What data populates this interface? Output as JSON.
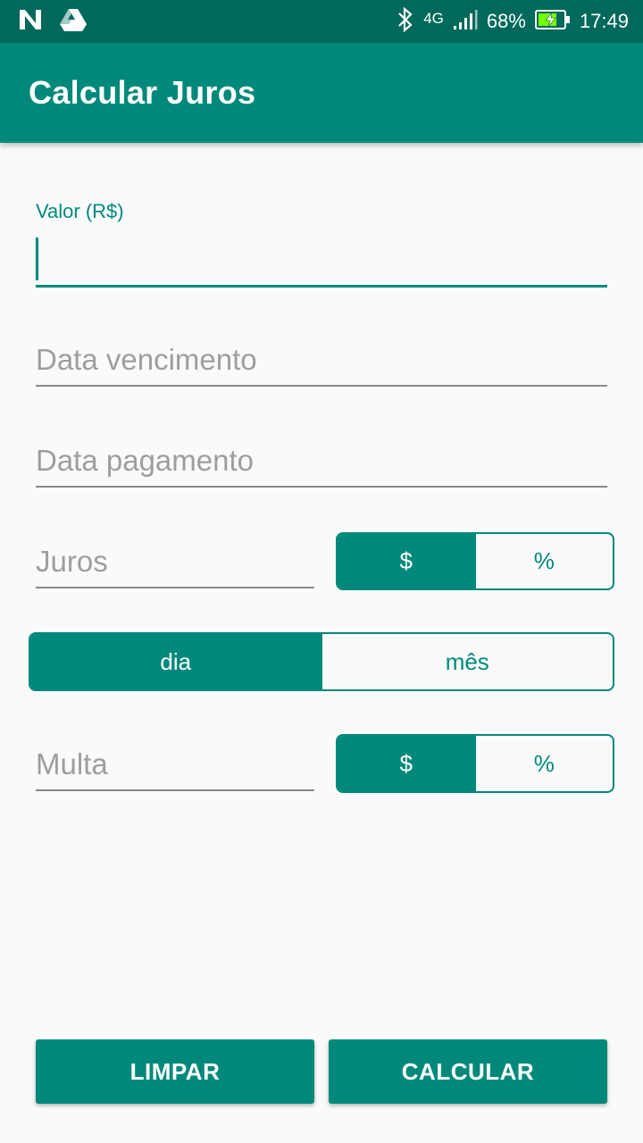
{
  "status_bar": {
    "network": "4G",
    "battery": "68%",
    "time": "17:49"
  },
  "app_bar": {
    "title": "Calcular Juros"
  },
  "form": {
    "valor": {
      "label": "Valor (R$)",
      "value": ""
    },
    "data_vencimento": {
      "placeholder": "Data vencimento",
      "value": ""
    },
    "data_pagamento": {
      "placeholder": "Data pagamento",
      "value": ""
    },
    "juros": {
      "placeholder": "Juros",
      "value": "",
      "unit_options": [
        "$",
        "%"
      ],
      "selected": "$"
    },
    "periodo": {
      "options": [
        "dia",
        "mês"
      ],
      "selected": "dia"
    },
    "multa": {
      "placeholder": "Multa",
      "value": "",
      "unit_options": [
        "$",
        "%"
      ],
      "selected": "$"
    }
  },
  "actions": {
    "clear_label": "LIMPAR",
    "calculate_label": "CALCULAR"
  },
  "colors": {
    "primary": "#00897b",
    "primary_dark": "#00695c",
    "background": "#fafafa"
  }
}
